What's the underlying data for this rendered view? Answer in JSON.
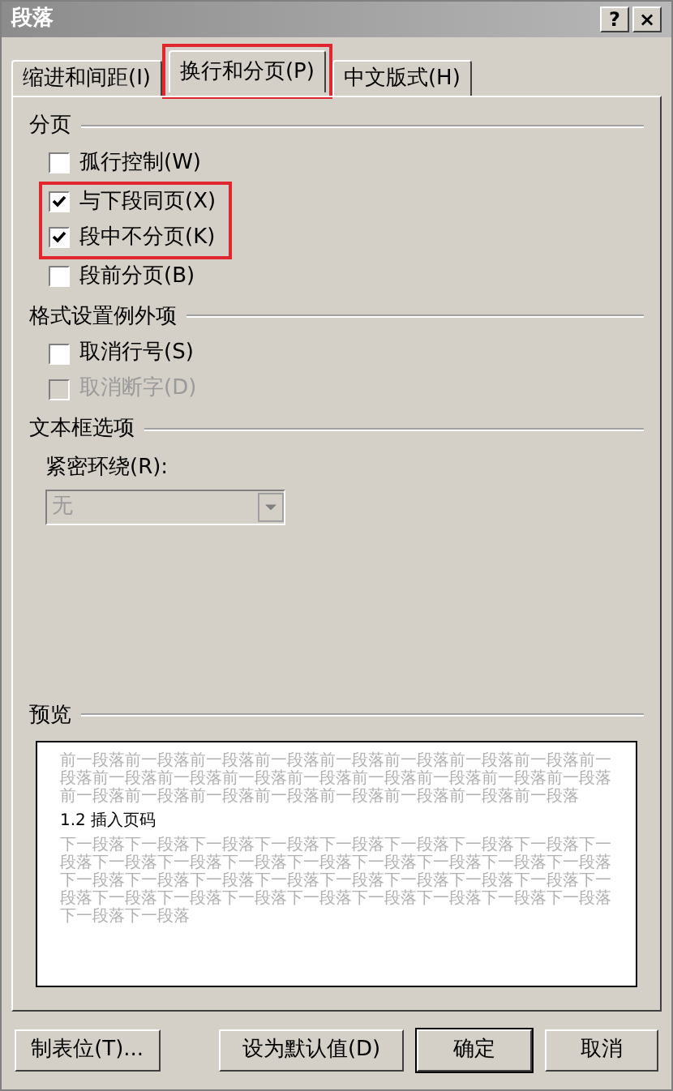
{
  "window": {
    "title": "段落",
    "buttons": [
      "?",
      "×"
    ]
  },
  "tabs": [
    {
      "label": "缩进和间距(I)",
      "selected": false,
      "highlighted": false
    },
    {
      "label": "换行和分页(P)",
      "selected": true,
      "highlighted": true
    },
    {
      "label": "中文版式(H)",
      "selected": false,
      "highlighted": false
    }
  ],
  "sections": [
    {
      "title": "分页",
      "checkboxes": [
        {
          "label": "孤行控制(W)",
          "checked": false,
          "disabled": false,
          "highlighted": false
        },
        {
          "label": "与下段同页(X)",
          "checked": true,
          "disabled": false,
          "highlighted": true
        },
        {
          "label": "段中不分页(K)",
          "checked": true,
          "disabled": false,
          "highlighted": true
        },
        {
          "label": "段前分页(B)",
          "checked": false,
          "disabled": false,
          "highlighted": false
        }
      ]
    },
    {
      "title": "格式设置例外项",
      "checkboxes": [
        {
          "label": "取消行号(S)",
          "checked": false,
          "disabled": false,
          "highlighted": false
        },
        {
          "label": "取消断字(D)",
          "checked": false,
          "disabled": true,
          "highlighted": false
        }
      ]
    },
    {
      "title": "文本框选项",
      "dropdown": {
        "label": "紧密环绕(R):",
        "value": "无",
        "disabled": true
      }
    }
  ],
  "preview": {
    "title": "预览",
    "previous_paragraph": "前一段落前一段落前一段落前一段落前一段落前一段落前一段落前一段落前一段落前一段落前一段落前一段落前一段落前一段落前一段落前一段落前一段落前一段落前一段落前一段落前一段落前一段落前一段落前一段落前一段落",
    "heading": "1.2 插入页码",
    "next_paragraph": "下一段落下一段落下一段落下一段落下一段落下一段落下一段落下一段落下一段落下一段落下一段落下一段落下一段落下一段落下一段落下一段落下一段落下一段落下一段落下一段落下一段落下一段落下一段落下一段落下一段落下一段落下一段落下一段落下一段落下一段落下一段落下一段落下一段落下一段落下一段落下一段落"
  },
  "footer_buttons": [
    "制表位(T)...",
    "设为默认值(D)",
    "确定",
    "取消"
  ]
}
